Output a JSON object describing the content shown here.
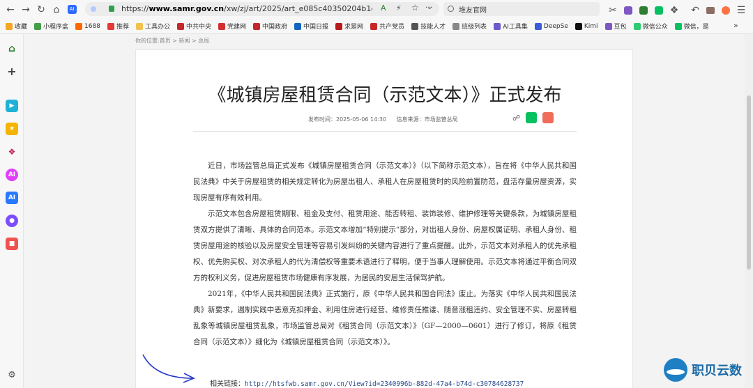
{
  "browser": {
    "url_prefix": "https://",
    "url_host": "www.samr.gov.cn",
    "url_path": "/xw/zj/art/2025/art_e085c40350204b1e84af59c",
    "search_text": "堆友官网"
  },
  "bookmarks": [
    {
      "label": "收藏",
      "color": "#f5a623"
    },
    {
      "label": "小程序盒",
      "color": "#43a047"
    },
    {
      "label": "1688",
      "color": "#ff6a00"
    },
    {
      "label": "推荐",
      "color": "#e53935"
    },
    {
      "label": "工具办公",
      "color": "#f2c14e"
    },
    {
      "label": "中共中央",
      "color": "#c62828"
    },
    {
      "label": "党建网",
      "color": "#d32f2f"
    },
    {
      "label": "中国政府",
      "color": "#c62828"
    },
    {
      "label": "中国日报",
      "color": "#1565c0"
    },
    {
      "label": "求是网",
      "color": "#b71c1c"
    },
    {
      "label": "共产党员",
      "color": "#c62828"
    },
    {
      "label": "技能人才",
      "color": "#555555"
    },
    {
      "label": "班级列表",
      "color": "#888888"
    },
    {
      "label": "AI工具集",
      "color": "#6a5acd"
    },
    {
      "label": "DeepSe",
      "color": "#3b5bdb"
    },
    {
      "label": "Kimi",
      "color": "#111111"
    },
    {
      "label": "豆包",
      "color": "#7e57c2"
    },
    {
      "label": "微信公众",
      "color": "#2ecc71"
    },
    {
      "label": "微信，是",
      "color": "#07c160"
    }
  ],
  "breadcrumb": "你的位置:首页 > 新闻 > 总局",
  "article": {
    "title": "《城镇房屋租赁合同（示范文本）》正式发布",
    "publish_time": "发布时间：2025-05-06 14:30",
    "source": "信息来源：市场监管总局",
    "paragraphs": [
      "近日，市场监管总局正式发布《城镇房屋租赁合同（示范文本）》（以下简称示范文本），旨在将《中华人民共和国民法典》中关于房屋租赁的相关规定转化为房屋出租人、承租人在房屋租赁时的风险前置防范，盘活存量房屋资源，实现房屋有序有效利用。",
      "示范文本包含房屋租赁期限、租金及支付、租赁用途、能否转租、装饰装修、维护修理等关键条款，为城镇房屋租赁双方提供了清晰、具体的合同范本。示范文本增加“特别提示”部分，对出租人身份、房屋权属证明、承租人身份、租赁房屋用途的核验以及房屋安全管理等容易引发纠纷的关键内容进行了重点提醒。此外，示范文本对承租人的优先承租权、优先购买权、对次承租人的代为清偿权等重要术语进行了释明，便于当事人理解使用。示范文本将通过平衡合同双方的权利义务，促进房屋租赁市场健康有序发展，为居民的安居生活保驾护航。",
      "2021年，《中华人民共和国民法典》正式施行，原《中华人民共和国合同法》废止。为落实《中华人民共和国民法典》新要求，遏制实践中恶意克扣押金、利用住房进行经营、维修责任推诿、随意涨租违约、安全管理不实、房屋转租乱象等城镇房屋租赁乱象，市场监管总局对《租赁合同（示范文本）》（GF—2000—0601）进行了修订，将原《租赁合同（示范文本）》细化为《城镇房屋租赁合同（示范文本）》。"
    ],
    "link_label": "相关链接：",
    "link_url": "http://htsfwb.samr.gov.cn/View?id=2340996b-882d-47a4-b74d-c30784628737"
  },
  "watermark": "职贝云数"
}
